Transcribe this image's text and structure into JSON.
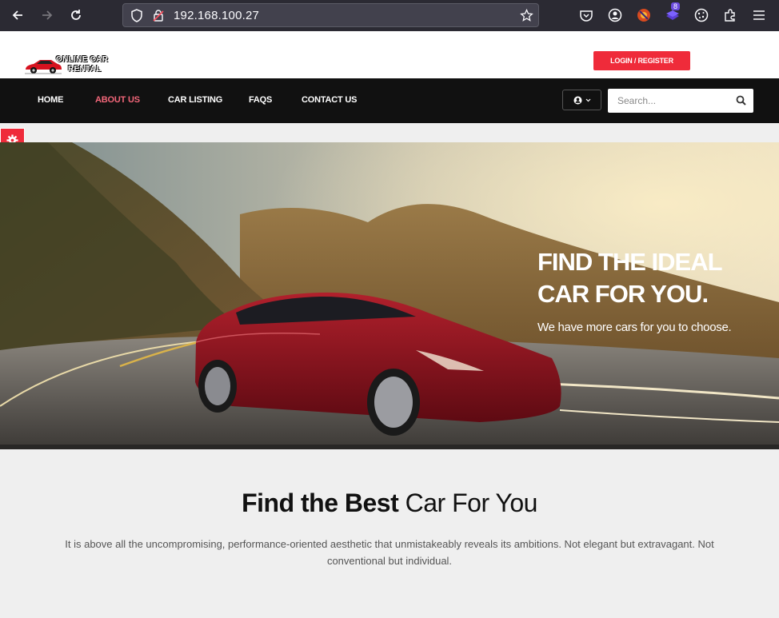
{
  "browser": {
    "url": "192.168.100.27",
    "badge_count": "8"
  },
  "header": {
    "logo_text_line1": "ONLINE CAR",
    "logo_text_line2": "RENTAL",
    "login_label": "LOGIN / REGISTER"
  },
  "nav": {
    "items": [
      {
        "label": "HOME"
      },
      {
        "label": "ABOUT US"
      },
      {
        "label": "CAR LISTING"
      },
      {
        "label": "FAQS"
      },
      {
        "label": "CONTACT US"
      }
    ],
    "search_placeholder": "Search..."
  },
  "hero": {
    "title_line1": "FIND THE IDEAL",
    "title_line2": "CAR FOR YOU.",
    "subtitle": "We have more cars for you to choose."
  },
  "intro": {
    "title_bold": "Find the Best",
    "title_light": "Car For You",
    "body": "It is above all the uncompromising, performance-oriented aesthetic that unmistakeably reveals its ambitions. Not elegant but extravagant. Not conventional but individual."
  },
  "colors": {
    "accent": "#ef2b3a",
    "nav_active": "#f4677a",
    "navbar_bg": "#111111"
  }
}
